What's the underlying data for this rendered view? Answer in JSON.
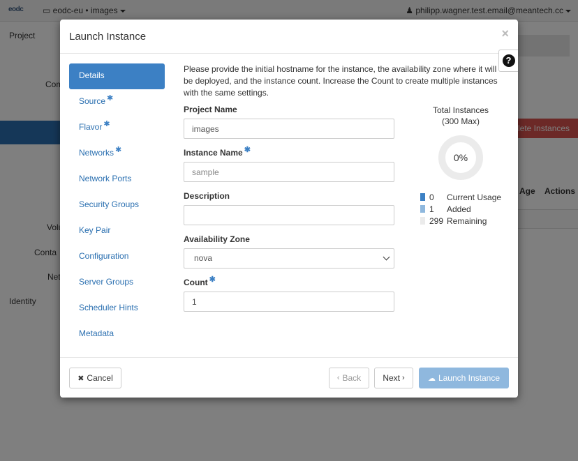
{
  "topbar": {
    "logo": "eodc",
    "project_switcher": "eodc-eu • images",
    "user_menu": "philipp.wagner.test.email@meantech.cc"
  },
  "background": {
    "side_labels": [
      "Project",
      "Com",
      "Volu",
      "Conta",
      "Net",
      "Identity"
    ],
    "danger_button": "lete Instances",
    "table_headers": [
      "Age",
      "Actions"
    ]
  },
  "modal": {
    "title": "Launch Instance",
    "help_icon": "question-circle-icon",
    "close_icon": "×",
    "nav": [
      {
        "label": "Details",
        "required": false,
        "active": true
      },
      {
        "label": "Source",
        "required": true,
        "active": false
      },
      {
        "label": "Flavor",
        "required": true,
        "active": false
      },
      {
        "label": "Networks",
        "required": true,
        "active": false
      },
      {
        "label": "Network Ports",
        "required": false,
        "active": false
      },
      {
        "label": "Security Groups",
        "required": false,
        "active": false
      },
      {
        "label": "Key Pair",
        "required": false,
        "active": false
      },
      {
        "label": "Configuration",
        "required": false,
        "active": false
      },
      {
        "label": "Server Groups",
        "required": false,
        "active": false
      },
      {
        "label": "Scheduler Hints",
        "required": false,
        "active": false
      },
      {
        "label": "Metadata",
        "required": false,
        "active": false
      }
    ],
    "intro": "Please provide the initial hostname for the instance, the availability zone where it will be deployed, and the instance count. Increase the Count to create multiple instances with the same settings.",
    "form": {
      "project_name_label": "Project Name",
      "project_name_value": "images",
      "instance_name_label": "Instance Name",
      "instance_name_placeholder": "sample",
      "description_label": "Description",
      "description_value": "",
      "availability_zone_label": "Availability Zone",
      "availability_zone_value": "nova",
      "count_label": "Count",
      "count_value": "1"
    },
    "quota": {
      "title_line1": "Total Instances",
      "title_line2": "(300 Max)",
      "percent": "0%",
      "fill_fraction": 0.0,
      "legend": [
        {
          "value": "0",
          "label": "Current Usage",
          "color": "#3c80c4"
        },
        {
          "value": "1",
          "label": "Added",
          "color": "#8fb8de"
        },
        {
          "value": "299",
          "label": "Remaining",
          "color": "#ebebeb"
        }
      ]
    },
    "footer": {
      "cancel": "Cancel",
      "back": "Back",
      "next": "Next",
      "launch": "Launch Instance"
    }
  }
}
